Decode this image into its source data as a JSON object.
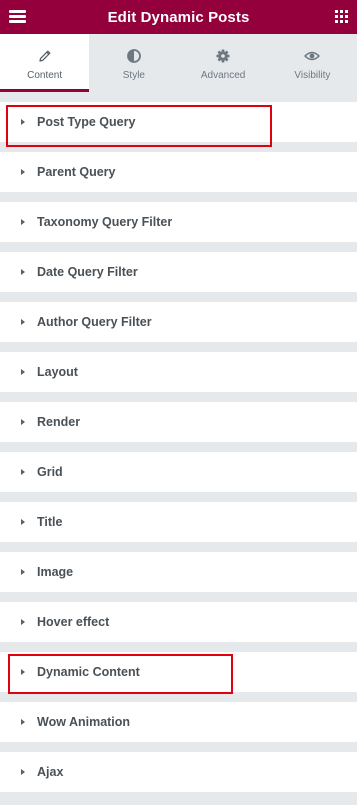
{
  "header": {
    "title": "Edit Dynamic Posts",
    "menu_icon": "hamburger-menu-icon",
    "apps_icon": "grid-apps-icon",
    "background": "#93003c"
  },
  "tabs": [
    {
      "label": "Content",
      "icon": "pencil-icon",
      "active": true
    },
    {
      "label": "Style",
      "icon": "half-circle-icon",
      "active": false
    },
    {
      "label": "Advanced",
      "icon": "gear-icon",
      "active": false
    },
    {
      "label": "Visibility",
      "icon": "eye-icon",
      "active": false
    }
  ],
  "sections": [
    {
      "label": "Post Type Query"
    },
    {
      "label": "Parent Query"
    },
    {
      "label": "Taxonomy Query Filter"
    },
    {
      "label": "Date Query Filter"
    },
    {
      "label": "Author Query Filter"
    },
    {
      "label": "Layout"
    },
    {
      "label": "Render"
    },
    {
      "label": "Grid"
    },
    {
      "label": "Title"
    },
    {
      "label": "Image"
    },
    {
      "label": "Hover effect"
    },
    {
      "label": "Dynamic Content"
    },
    {
      "label": "Wow Animation"
    },
    {
      "label": "Ajax"
    }
  ],
  "highlight_color": "#e0000f"
}
